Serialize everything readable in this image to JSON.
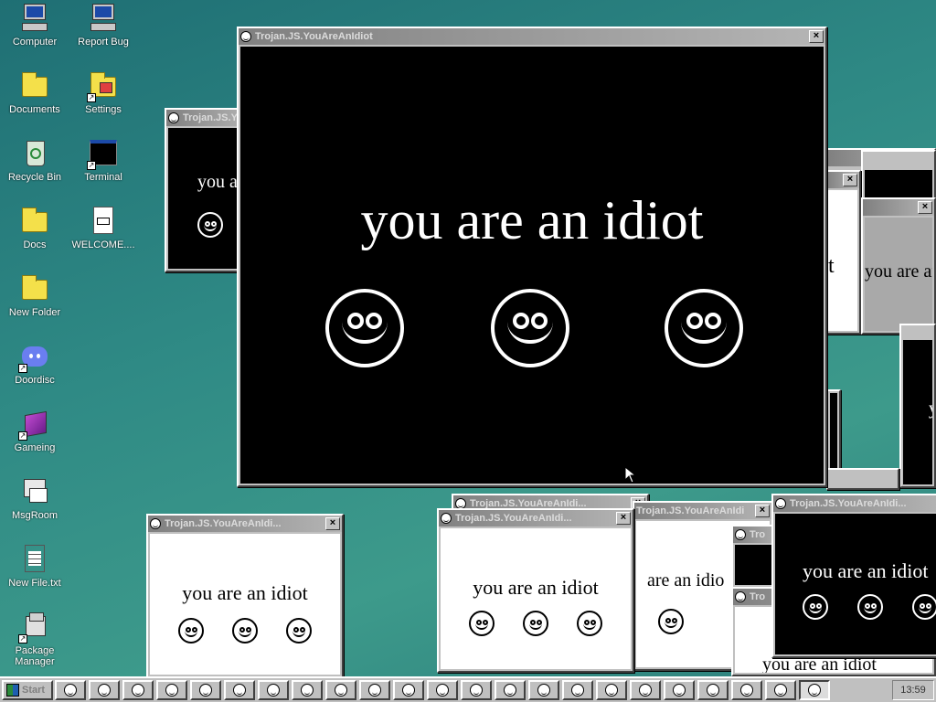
{
  "desktop": {
    "icons": [
      {
        "label": "Computer",
        "icon": "computer-icon"
      },
      {
        "label": "Report Bug",
        "icon": "computer-icon"
      },
      {
        "label": "Documents",
        "icon": "folder-icon"
      },
      {
        "label": "Settings",
        "icon": "settings-icon"
      },
      {
        "label": "Recycle Bin",
        "icon": "recycle-bin-icon"
      },
      {
        "label": "Terminal",
        "icon": "terminal-icon"
      },
      {
        "label": "Docs",
        "icon": "folder-icon"
      },
      {
        "label": "WELCOME....",
        "icon": "markdown-file-icon"
      },
      {
        "label": "New Folder",
        "icon": "folder-icon"
      },
      {
        "label": "Doordisc",
        "icon": "discord-icon"
      },
      {
        "label": "Gameing",
        "icon": "cube-icon"
      },
      {
        "label": "MsgRoom",
        "icon": "msgroom-icon"
      },
      {
        "label": "New File.txt",
        "icon": "text-file-icon"
      },
      {
        "label": "Package Manager",
        "icon": "package-icon"
      }
    ]
  },
  "popup": {
    "title": "Trojan.JS.YouAreAnIdiot",
    "title_short": "Trojan.JS.YouAreAnIdi...",
    "title_clip1": "Trojan.JS.Y",
    "title_clip2": "Trojan.JS.YouAreAnIdi",
    "title_clip3": "Tro",
    "message": "you are an idiot",
    "msg_clip_left": "you a",
    "msg_clip_mid": "are an idio",
    "msg_clip_right": "you are an",
    "msg_clip_far": "y",
    "close_glyph": "×"
  },
  "taskbar": {
    "start_label": "Start",
    "clock": "13:59"
  },
  "colors": {
    "desktop": "#2f8a85",
    "title_inactive": "#808080",
    "window_face": "#c0c0c0"
  }
}
